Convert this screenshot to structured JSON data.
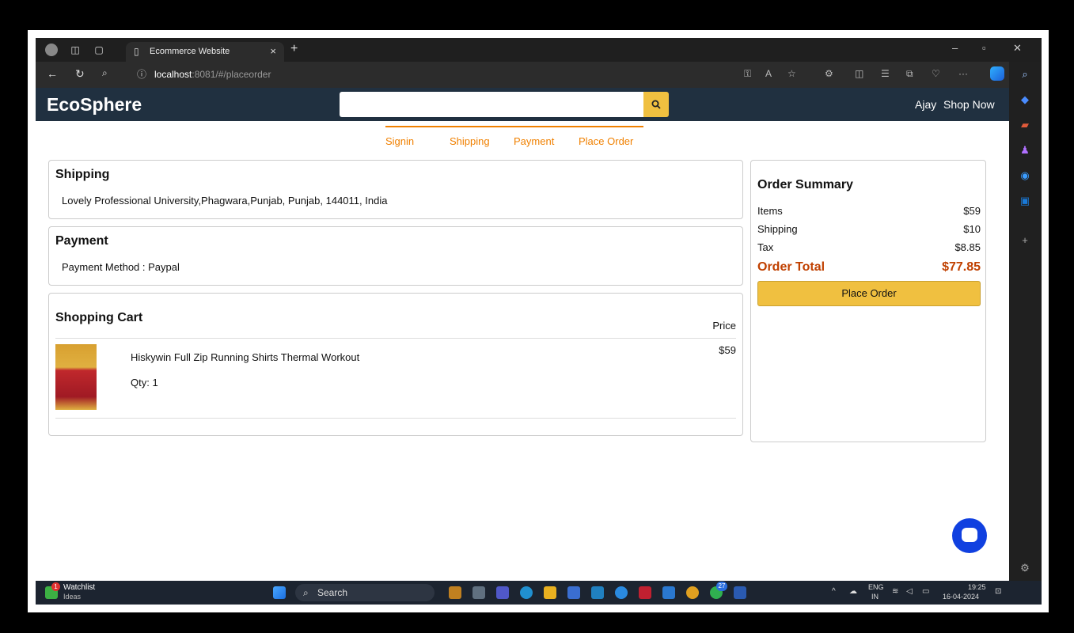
{
  "browser": {
    "tab_title": "Ecommerce Website",
    "url_host": "localhost",
    "url_path": ":8081/#/placeorder"
  },
  "header": {
    "brand": "EcoSphere",
    "search_placeholder": "",
    "user_link": "Ajay",
    "shop_link": "Shop Now"
  },
  "steps": [
    "Signin",
    "Shipping",
    "Payment",
    "Place Order"
  ],
  "shipping": {
    "title": "Shipping",
    "address": "Lovely Professional University,Phagwara,Punjab, Punjab, 144011, India"
  },
  "payment": {
    "title": "Payment",
    "method": "Payment Method : Paypal"
  },
  "cart": {
    "title": "Shopping Cart",
    "price_header": "Price",
    "items": [
      {
        "name": "Hiskywin Full Zip Running Shirts Thermal Workout",
        "qty": "Qty: 1",
        "price": "$59"
      }
    ]
  },
  "summary": {
    "title": "Order Summary",
    "rows": [
      {
        "label": "Items",
        "value": "$59"
      },
      {
        "label": "Shipping",
        "value": "$10"
      },
      {
        "label": "Tax",
        "value": "$8.85"
      }
    ],
    "total_label": "Order Total",
    "total_value": "$77.85",
    "button": "Place Order"
  },
  "taskbar": {
    "widget_title": "Watchlist",
    "widget_sub": "Ideas",
    "widget_badge": "1",
    "search": "Search",
    "whatsapp_badge": "27",
    "lang": "ENG",
    "region": "IN",
    "time": "19:25",
    "date": "16-04-2024"
  },
  "colors": {
    "header_bg": "#203040",
    "accent": "#f0c040",
    "step_color": "#f08000",
    "total_color": "#c04000"
  }
}
